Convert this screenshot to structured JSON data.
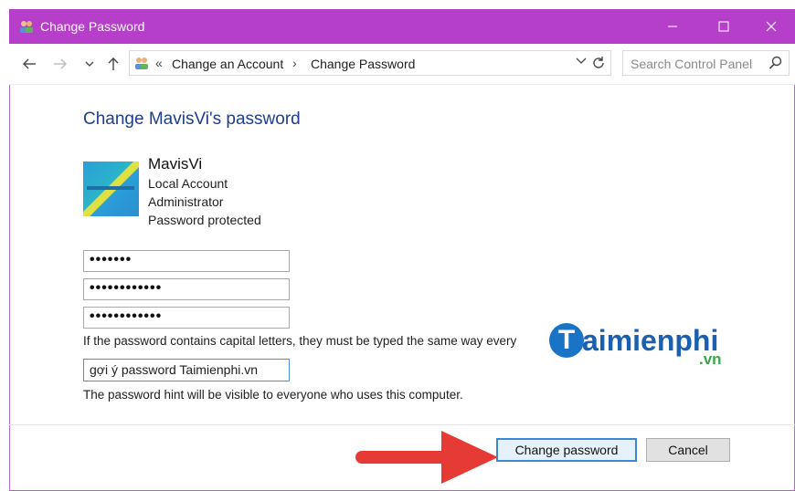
{
  "window": {
    "title": "Change Password",
    "colors": {
      "titlebar": "#b63fca",
      "heading": "#1e3d8f"
    }
  },
  "navbar": {
    "breadcrumb_prefix": "«",
    "crumbs": [
      "Change an Account",
      "Change Password"
    ],
    "crumb_separator": "›",
    "search_placeholder": "Search Control Panel"
  },
  "main": {
    "heading": "Change MavisVi's password",
    "user": {
      "name": "MavisVi",
      "lines": [
        "Local Account",
        "Administrator",
        "Password protected"
      ]
    },
    "fields": {
      "current_password_mask": "•••••••",
      "new_password_mask": "••••••••••••",
      "confirm_password_mask": "••••••••••••",
      "hint_value": "gợi ý password Taimienphi.vn"
    },
    "capitals_note": "If the password contains capital letters, they must be typed the same way every",
    "hint_note": "The password hint will be visible to everyone who uses this computer."
  },
  "watermark": {
    "letter": "T",
    "word": "aimienphi",
    "suffix": ".vn"
  },
  "buttons": {
    "change": "Change password",
    "cancel": "Cancel"
  }
}
